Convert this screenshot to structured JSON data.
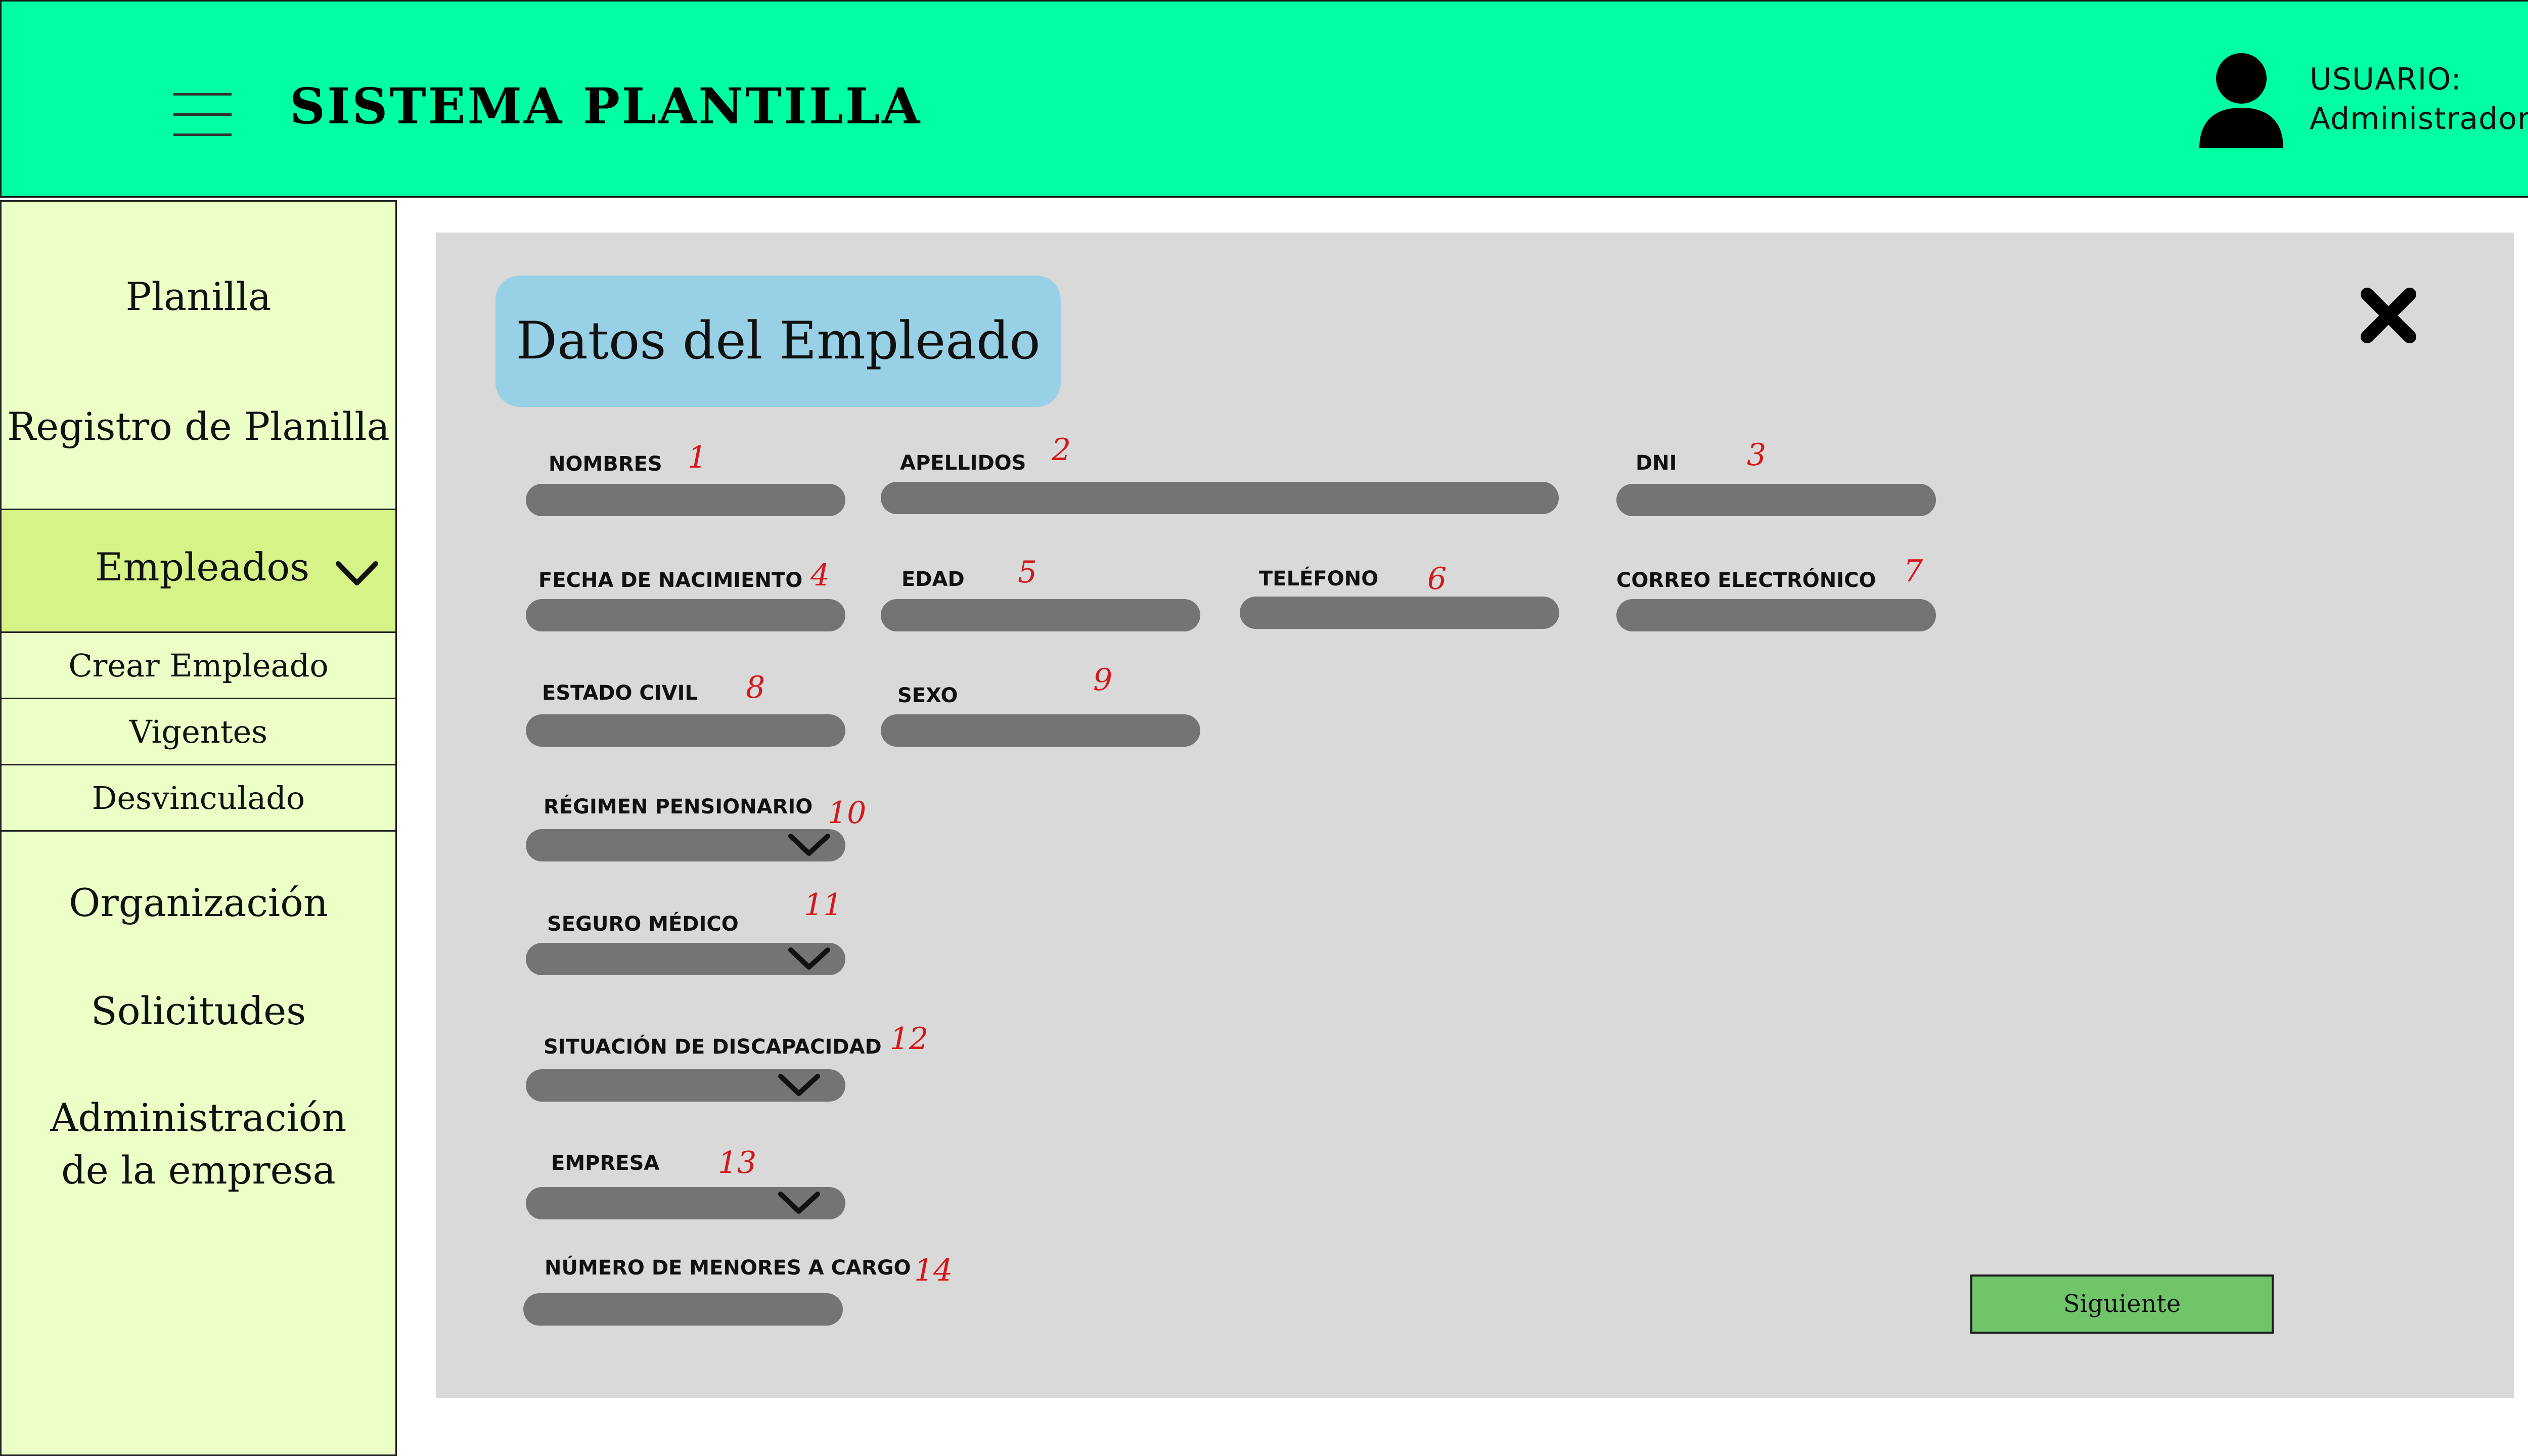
{
  "header": {
    "app_title": "SISTEMA PLANTILLA",
    "user_label": "USUARIO:",
    "user_name": "Administrador",
    "menu_icon": "hamburger-menu-icon",
    "user_icon": "user-silhouette-icon",
    "background_color": "#00ffa2"
  },
  "sidebar": {
    "background_color": "#ebffc6",
    "active_color": "#d5f386",
    "planilla": "Planilla",
    "registro": "Registro de Planilla",
    "empleados": "Empleados",
    "empleados_sub": [
      "Crear Empleado",
      "Vigentes",
      "Desvinculado"
    ],
    "organizacion": "Organización",
    "solicitudes": "Solicitudes",
    "administracion_line1": "Administración",
    "administracion_line2": "de la empresa"
  },
  "form": {
    "title": "Datos del Empleado",
    "close_icon": "close-x-icon",
    "fields": [
      {
        "label": "NOMBRES",
        "num": "1"
      },
      {
        "label": "APELLIDOS",
        "num": "2"
      },
      {
        "label": "DNI",
        "num": "3"
      },
      {
        "label": "FECHA DE NACIMIENTO",
        "num": "4"
      },
      {
        "label": "EDAD",
        "num": "5"
      },
      {
        "label": "TELÉFONO",
        "num": "6"
      },
      {
        "label": "CORREO ELECTRÓNICO",
        "num": "7"
      },
      {
        "label": "ESTADO CIVIL",
        "num": "8"
      },
      {
        "label": "SEXO",
        "num": "9"
      },
      {
        "label": "RÉGIMEN PENSIONARIO",
        "num": "10"
      },
      {
        "label": "SEGURO MÉDICO",
        "num": "11"
      },
      {
        "label": "SITUACIÓN DE DISCAPACIDAD",
        "num": "12"
      },
      {
        "label": "EMPRESA",
        "num": "13"
      },
      {
        "label": "NÚMERO DE MENORES A CARGO",
        "num": "14"
      }
    ],
    "next_button": "Siguiente",
    "title_color": "#98d1e6",
    "field_color": "#747474",
    "annotation_color": "#d4171c",
    "button_color": "#71c569"
  }
}
